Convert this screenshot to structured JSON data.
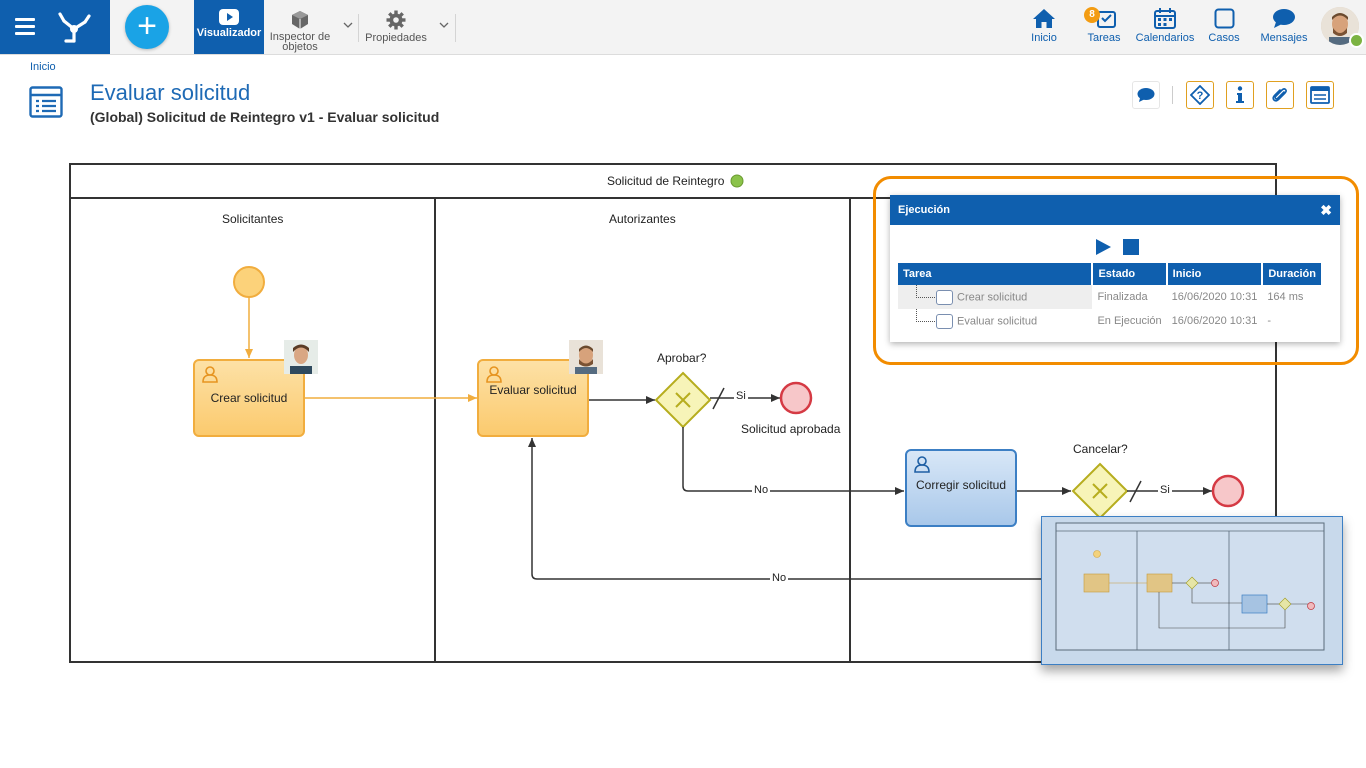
{
  "toolbar": {
    "visualizer_label": "Visualizador",
    "inspector_label_1": "Inspector de",
    "inspector_label_2": "objetos",
    "properties_label": "Propiedades"
  },
  "nav": {
    "home": "Inicio",
    "tasks": "Tareas",
    "tasks_badge": "8",
    "calendars": "Calendarios",
    "cases": "Casos",
    "messages": "Mensajes"
  },
  "header": {
    "breadcrumb": "Inicio",
    "title": "Evaluar solicitud",
    "subtitle": "(Global) Solicitud de Reintegro v1 - Evaluar solicitud"
  },
  "diagram": {
    "pool_name": "Solicitud de Reintegro",
    "lanes": [
      "Solicitantes",
      "Autorizantes",
      ""
    ],
    "tasks": {
      "crear": "Crear solicitud",
      "evaluar": "Evaluar solicitud",
      "corregir": "Corregir solicitud"
    },
    "gateways": {
      "aprobar": "Aprobar?",
      "cancelar": "Cancelar?"
    },
    "flows": {
      "si_1": "Si",
      "no_1": "No",
      "si_2": "Si",
      "no_2": "No"
    },
    "end_event_label": "Solicitud aprobada"
  },
  "execution": {
    "title": "Ejecución",
    "columns": [
      "Tarea",
      "Estado",
      "Inicio",
      "Duración"
    ],
    "rows": [
      {
        "task": "Crear solicitud",
        "state": "Finalizada",
        "start": "16/06/2020 10:31",
        "duration": "164 ms"
      },
      {
        "task": "Evaluar solicitud",
        "state": "En Ejecución",
        "start": "16/06/2020 10:31",
        "duration": "-"
      }
    ]
  },
  "colors": {
    "primary": "#0f5fae",
    "highlight": "#f28c00",
    "task_orange": "#fbca6e",
    "task_blue": "#a9c8ea"
  }
}
